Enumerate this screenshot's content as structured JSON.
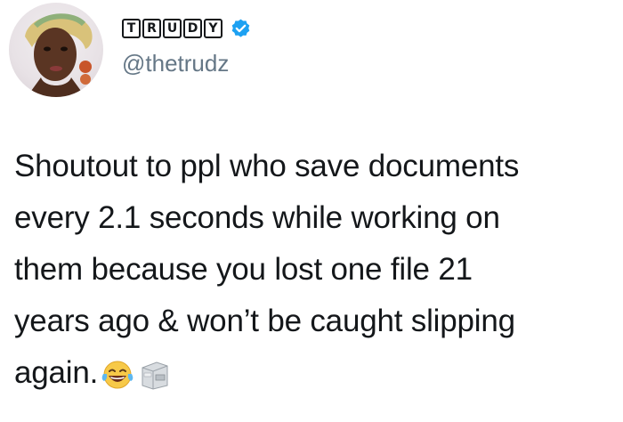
{
  "author": {
    "display_name_letters": [
      "T",
      "R",
      "U",
      "D",
      "Y"
    ],
    "handle": "@thetrudz",
    "verified": true,
    "verified_icon": "verified-badge-icon",
    "avatar_icon": "profile-photo"
  },
  "tweet": {
    "lines": [
      "Shoutout to ppl who save documents",
      "every 2.1 seconds while working on",
      "them because you lost one file 21",
      "years ago & won’t be caught slipping",
      "again."
    ],
    "emojis": [
      "face-with-tears-of-joy-icon",
      "file-cabinet-icon"
    ]
  },
  "colors": {
    "text": "#14171a",
    "handle": "#657786",
    "verified": "#1da1f2",
    "background": "#ffffff"
  }
}
